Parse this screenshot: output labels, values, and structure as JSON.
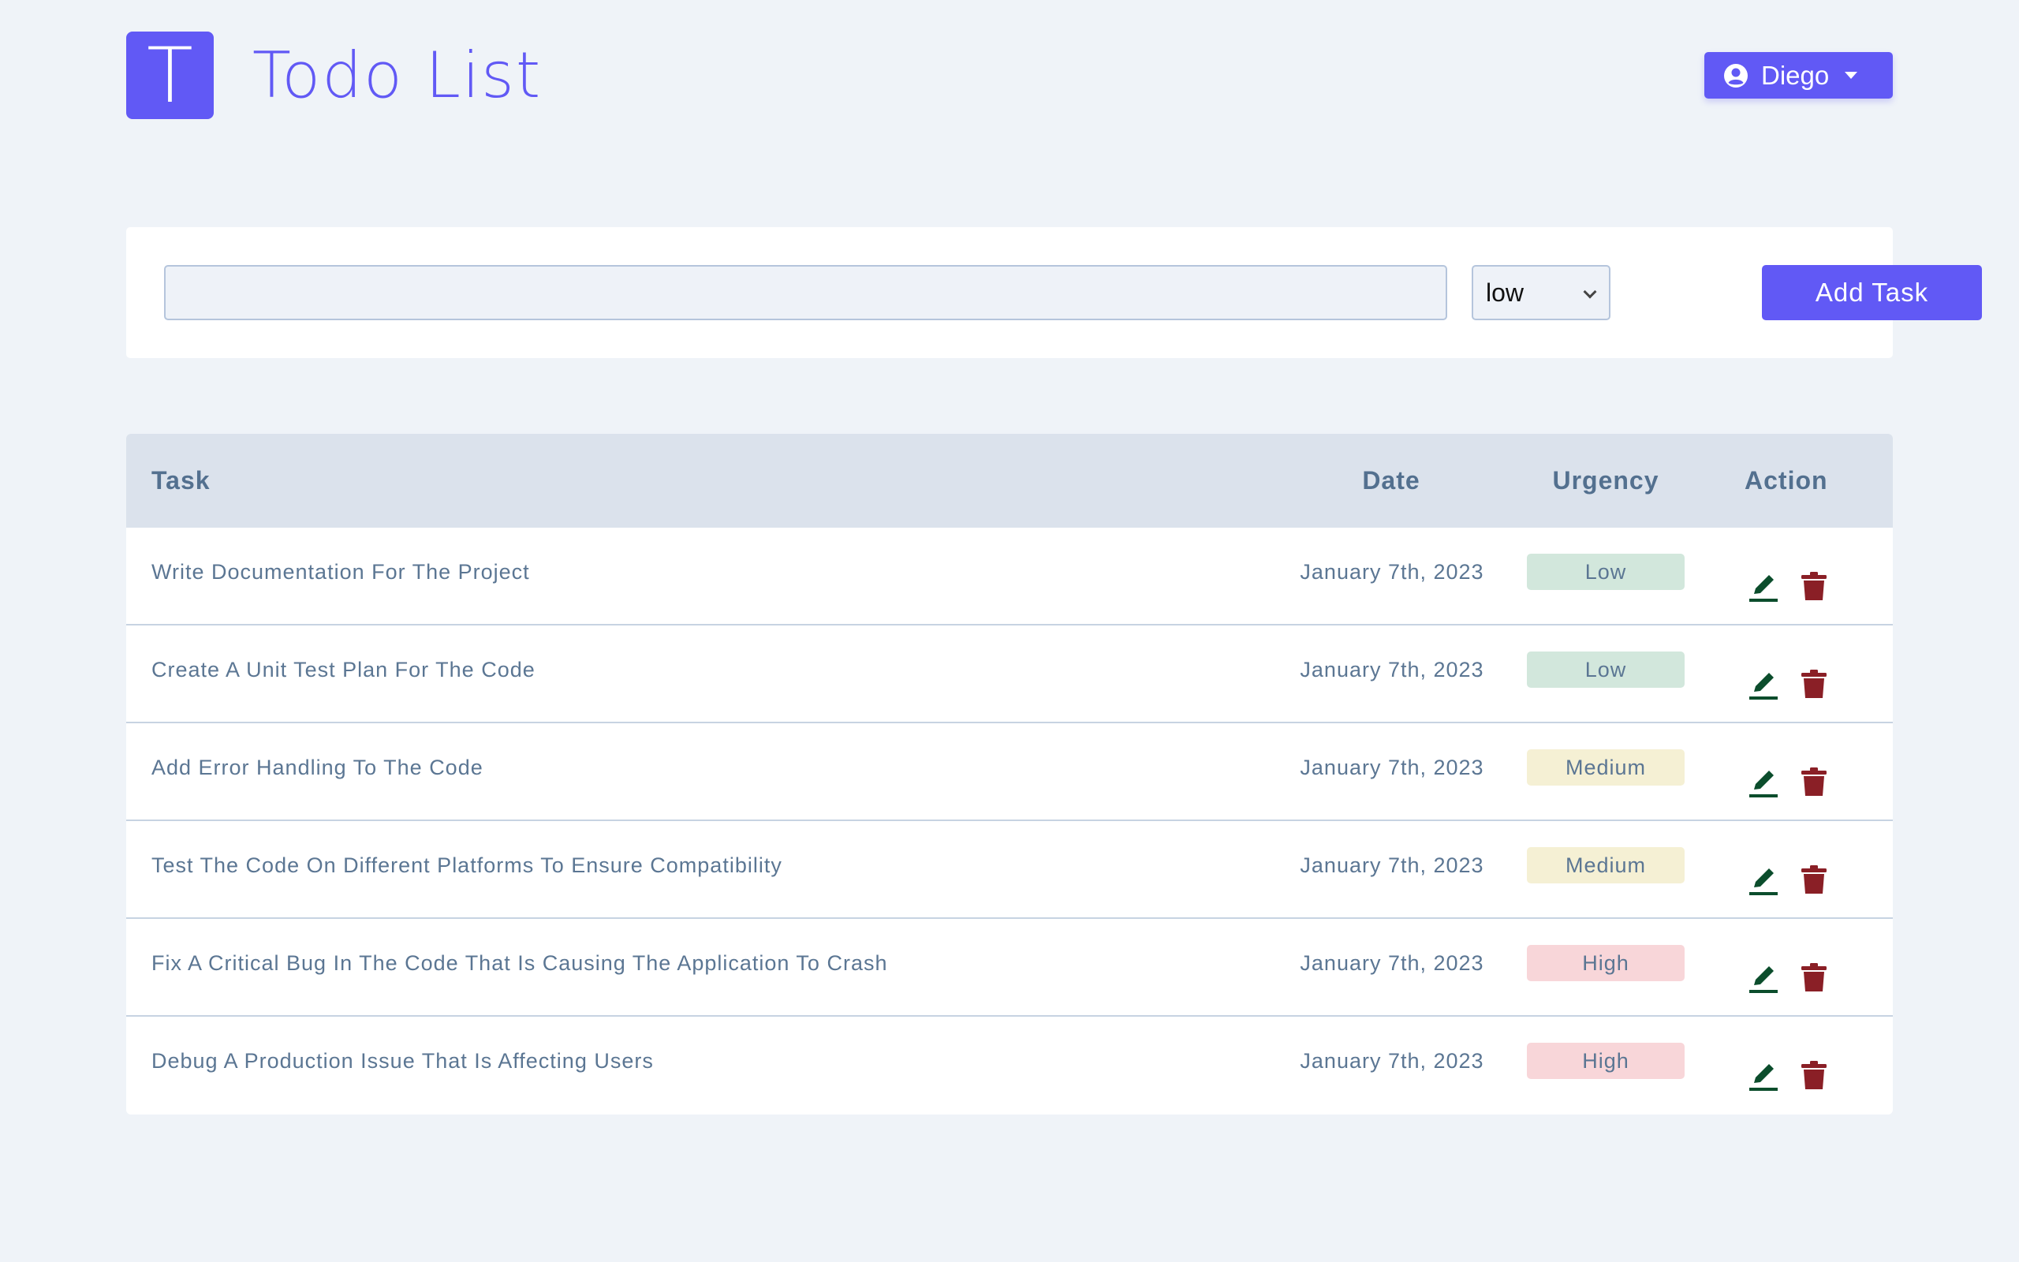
{
  "header": {
    "logo_letter": "T",
    "title": "Todo List",
    "user_name": "Diego"
  },
  "form": {
    "task_input_value": "",
    "urgency_selected": "low",
    "add_button_label": "Add Task"
  },
  "table": {
    "columns": {
      "task": "Task",
      "date": "Date",
      "urgency": "Urgency",
      "action": "Action"
    },
    "rows": [
      {
        "task": "Write Documentation For The Project",
        "date": "January 7th, 2023",
        "urgency": "Low",
        "badge_color": "#d2e7dc"
      },
      {
        "task": "Create A Unit Test Plan For The Code",
        "date": "January 7th, 2023",
        "urgency": "Low",
        "badge_color": "#d2e7dc"
      },
      {
        "task": "Add Error Handling To The Code",
        "date": "January 7th, 2023",
        "urgency": "Medium",
        "badge_color": "#f5f0d4"
      },
      {
        "task": "Test The Code On Different Platforms To Ensure Compatibility",
        "date": "January 7th, 2023",
        "urgency": "Medium",
        "badge_color": "#f5f0d4"
      },
      {
        "task": "Fix A Critical Bug In The Code That Is Causing The Application To Crash",
        "date": "January 7th, 2023",
        "urgency": "High",
        "badge_color": "#f8d6d9"
      },
      {
        "task": "Debug A Production Issue That Is Affecting Users",
        "date": "January 7th, 2023",
        "urgency": "High",
        "badge_color": "#f8d6d9"
      }
    ]
  },
  "colors": {
    "accent": "#6159f5",
    "background": "#eff3f8",
    "edit_icon": "#0b4d2c",
    "delete_icon": "#8a1f26"
  },
  "icons": {
    "user": "user-circle-icon",
    "edit": "pencil-icon",
    "delete": "trash-icon"
  }
}
